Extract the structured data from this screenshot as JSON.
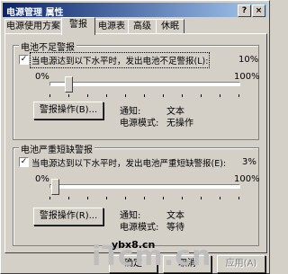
{
  "window": {
    "title": "电源管理 属性",
    "help_button": "?",
    "close_button": "×"
  },
  "tabs": [
    "电源使用方案",
    "警报",
    "电源表",
    "高级",
    "休眠"
  ],
  "active_tab_index": 1,
  "low_battery": {
    "group_title": "电池不足警报",
    "checkbox_checked": true,
    "checkbox_label": "当电源达到以下水平时，发出电池不足警报(L):",
    "level_text": "10%",
    "level_fraction": 0.1,
    "slider_min": "0%",
    "slider_max": "100%",
    "action_button": "警报操作(B)...",
    "notify_label": "通知:",
    "notify_value": "文本",
    "mode_label": "电源模式:",
    "mode_value": "无操作"
  },
  "critical_battery": {
    "group_title": "电池严重短缺警报",
    "checkbox_checked": true,
    "checkbox_label": "当电源达到以下水平时，发出电池严重短缺警报(E):",
    "level_text": "3%",
    "level_fraction": 0.03,
    "slider_min": "0%",
    "slider_max": "100%",
    "action_button": "警报操作(R)...",
    "notify_label": "通知:",
    "notify_value": "文本",
    "mode_label": "电源模式:",
    "mode_value": "等待"
  },
  "footer": {
    "ok": "确定",
    "cancel": "取消",
    "apply": "应用(A)"
  },
  "watermark": {
    "site": "ybx8.cn",
    "logo": "iTcm.cn"
  }
}
